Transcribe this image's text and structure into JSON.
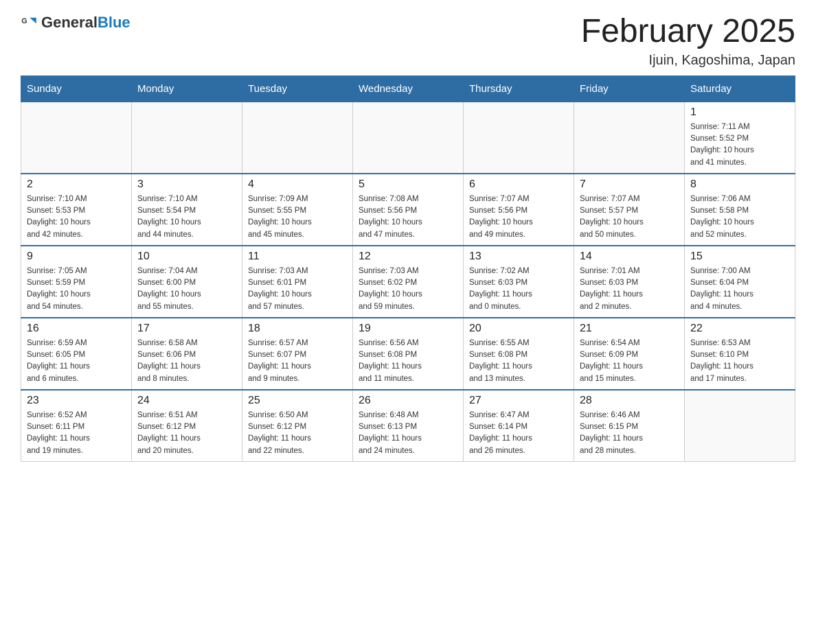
{
  "header": {
    "logo_general": "General",
    "logo_blue": "Blue",
    "title": "February 2025",
    "subtitle": "Ijuin, Kagoshima, Japan"
  },
  "weekdays": [
    "Sunday",
    "Monday",
    "Tuesday",
    "Wednesday",
    "Thursday",
    "Friday",
    "Saturday"
  ],
  "weeks": [
    [
      {
        "day": "",
        "info": ""
      },
      {
        "day": "",
        "info": ""
      },
      {
        "day": "",
        "info": ""
      },
      {
        "day": "",
        "info": ""
      },
      {
        "day": "",
        "info": ""
      },
      {
        "day": "",
        "info": ""
      },
      {
        "day": "1",
        "info": "Sunrise: 7:11 AM\nSunset: 5:52 PM\nDaylight: 10 hours\nand 41 minutes."
      }
    ],
    [
      {
        "day": "2",
        "info": "Sunrise: 7:10 AM\nSunset: 5:53 PM\nDaylight: 10 hours\nand 42 minutes."
      },
      {
        "day": "3",
        "info": "Sunrise: 7:10 AM\nSunset: 5:54 PM\nDaylight: 10 hours\nand 44 minutes."
      },
      {
        "day": "4",
        "info": "Sunrise: 7:09 AM\nSunset: 5:55 PM\nDaylight: 10 hours\nand 45 minutes."
      },
      {
        "day": "5",
        "info": "Sunrise: 7:08 AM\nSunset: 5:56 PM\nDaylight: 10 hours\nand 47 minutes."
      },
      {
        "day": "6",
        "info": "Sunrise: 7:07 AM\nSunset: 5:56 PM\nDaylight: 10 hours\nand 49 minutes."
      },
      {
        "day": "7",
        "info": "Sunrise: 7:07 AM\nSunset: 5:57 PM\nDaylight: 10 hours\nand 50 minutes."
      },
      {
        "day": "8",
        "info": "Sunrise: 7:06 AM\nSunset: 5:58 PM\nDaylight: 10 hours\nand 52 minutes."
      }
    ],
    [
      {
        "day": "9",
        "info": "Sunrise: 7:05 AM\nSunset: 5:59 PM\nDaylight: 10 hours\nand 54 minutes."
      },
      {
        "day": "10",
        "info": "Sunrise: 7:04 AM\nSunset: 6:00 PM\nDaylight: 10 hours\nand 55 minutes."
      },
      {
        "day": "11",
        "info": "Sunrise: 7:03 AM\nSunset: 6:01 PM\nDaylight: 10 hours\nand 57 minutes."
      },
      {
        "day": "12",
        "info": "Sunrise: 7:03 AM\nSunset: 6:02 PM\nDaylight: 10 hours\nand 59 minutes."
      },
      {
        "day": "13",
        "info": "Sunrise: 7:02 AM\nSunset: 6:03 PM\nDaylight: 11 hours\nand 0 minutes."
      },
      {
        "day": "14",
        "info": "Sunrise: 7:01 AM\nSunset: 6:03 PM\nDaylight: 11 hours\nand 2 minutes."
      },
      {
        "day": "15",
        "info": "Sunrise: 7:00 AM\nSunset: 6:04 PM\nDaylight: 11 hours\nand 4 minutes."
      }
    ],
    [
      {
        "day": "16",
        "info": "Sunrise: 6:59 AM\nSunset: 6:05 PM\nDaylight: 11 hours\nand 6 minutes."
      },
      {
        "day": "17",
        "info": "Sunrise: 6:58 AM\nSunset: 6:06 PM\nDaylight: 11 hours\nand 8 minutes."
      },
      {
        "day": "18",
        "info": "Sunrise: 6:57 AM\nSunset: 6:07 PM\nDaylight: 11 hours\nand 9 minutes."
      },
      {
        "day": "19",
        "info": "Sunrise: 6:56 AM\nSunset: 6:08 PM\nDaylight: 11 hours\nand 11 minutes."
      },
      {
        "day": "20",
        "info": "Sunrise: 6:55 AM\nSunset: 6:08 PM\nDaylight: 11 hours\nand 13 minutes."
      },
      {
        "day": "21",
        "info": "Sunrise: 6:54 AM\nSunset: 6:09 PM\nDaylight: 11 hours\nand 15 minutes."
      },
      {
        "day": "22",
        "info": "Sunrise: 6:53 AM\nSunset: 6:10 PM\nDaylight: 11 hours\nand 17 minutes."
      }
    ],
    [
      {
        "day": "23",
        "info": "Sunrise: 6:52 AM\nSunset: 6:11 PM\nDaylight: 11 hours\nand 19 minutes."
      },
      {
        "day": "24",
        "info": "Sunrise: 6:51 AM\nSunset: 6:12 PM\nDaylight: 11 hours\nand 20 minutes."
      },
      {
        "day": "25",
        "info": "Sunrise: 6:50 AM\nSunset: 6:12 PM\nDaylight: 11 hours\nand 22 minutes."
      },
      {
        "day": "26",
        "info": "Sunrise: 6:48 AM\nSunset: 6:13 PM\nDaylight: 11 hours\nand 24 minutes."
      },
      {
        "day": "27",
        "info": "Sunrise: 6:47 AM\nSunset: 6:14 PM\nDaylight: 11 hours\nand 26 minutes."
      },
      {
        "day": "28",
        "info": "Sunrise: 6:46 AM\nSunset: 6:15 PM\nDaylight: 11 hours\nand 28 minutes."
      },
      {
        "day": "",
        "info": ""
      }
    ]
  ]
}
